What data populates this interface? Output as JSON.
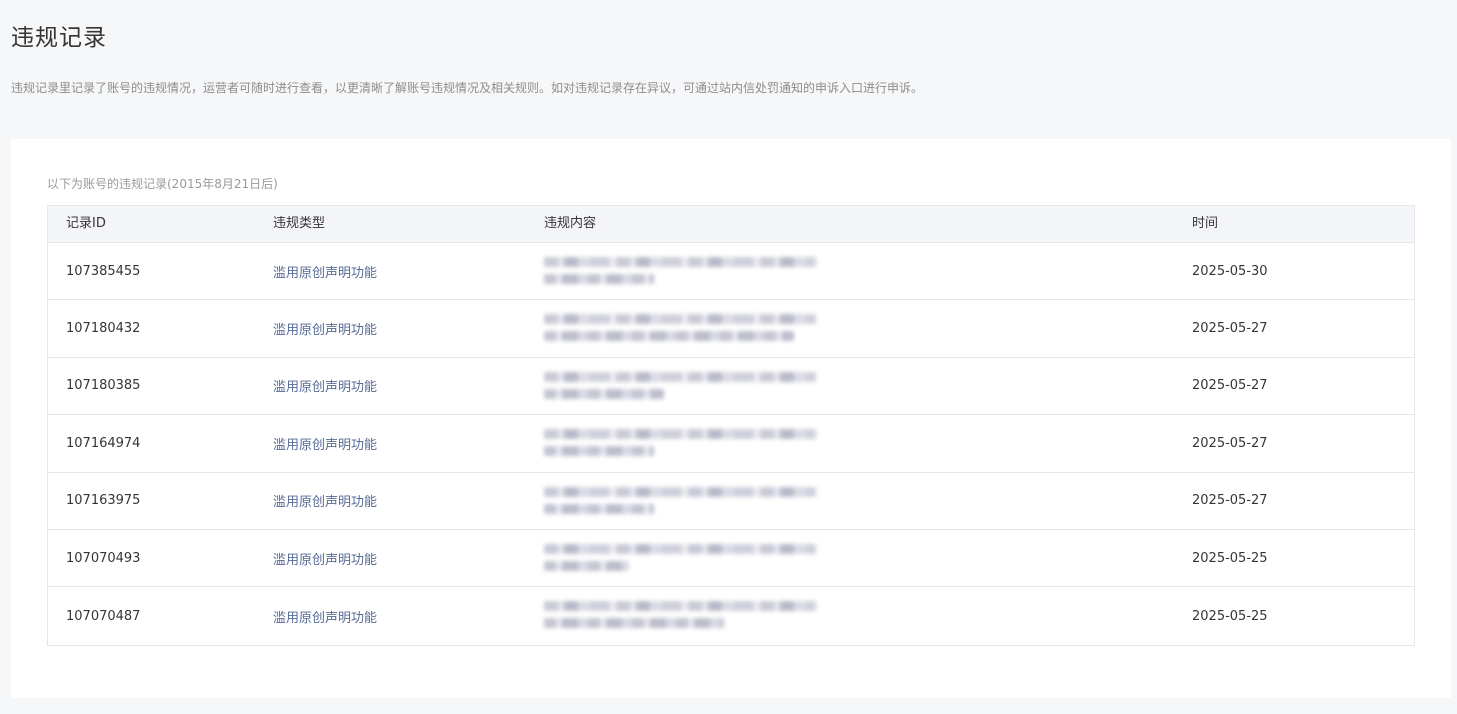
{
  "page": {
    "title": "违规记录",
    "description": "违规记录里记录了账号的违规情况，运营者可随时进行查看，以更清晰了解账号违规情况及相关规则。如对违规记录存在异议，可通过站内信处罚通知的申诉入口进行申诉。"
  },
  "table": {
    "caption": "以下为账号的违规记录(2015年8月21日后)",
    "headers": {
      "id": "记录ID",
      "type": "违规类型",
      "content": "违规内容",
      "time": "时间"
    },
    "rows": [
      {
        "id": "107385455",
        "type": "滥用原创声明功能",
        "time": "2025-05-30"
      },
      {
        "id": "107180432",
        "type": "滥用原创声明功能",
        "time": "2025-05-27"
      },
      {
        "id": "107180385",
        "type": "滥用原创声明功能",
        "time": "2025-05-27"
      },
      {
        "id": "107164974",
        "type": "滥用原创声明功能",
        "time": "2025-05-27"
      },
      {
        "id": "107163975",
        "type": "滥用原创声明功能",
        "time": "2025-05-27"
      },
      {
        "id": "107070493",
        "type": "滥用原创声明功能",
        "time": "2025-05-25"
      },
      {
        "id": "107070487",
        "type": "滥用原创声明功能",
        "time": "2025-05-25"
      }
    ]
  },
  "colors": {
    "background": "#f6f7f9",
    "card": "#ffffff",
    "link": "#576b95",
    "header_bg": "#f4f5f9",
    "border": "#e7e7eb"
  }
}
